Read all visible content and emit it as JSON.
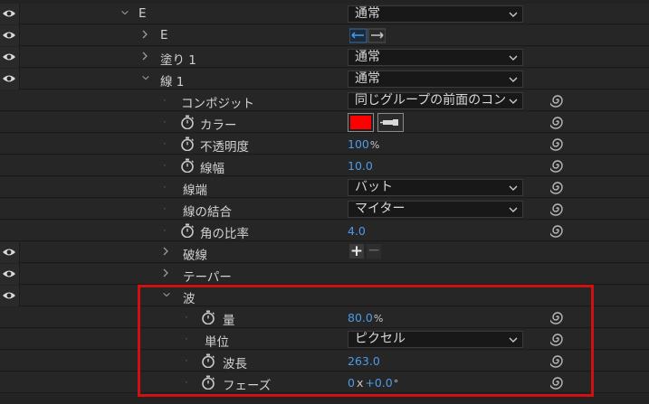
{
  "rows": [
    {
      "label": "E",
      "dropdown": "通常"
    },
    {
      "label": "E"
    },
    {
      "label": "塗り 1",
      "dropdown": "通常"
    },
    {
      "label": "線 1",
      "dropdown": "通常"
    },
    {
      "label": "コンポジット",
      "dropdown": "同じグループの前面のコン"
    },
    {
      "label": "カラー",
      "color": "#ff0000"
    },
    {
      "label": "不透明度",
      "value": "100",
      "unit": "%"
    },
    {
      "label": "線幅",
      "value": "10.0"
    },
    {
      "label": "線端",
      "dropdown": "バット"
    },
    {
      "label": "線の結合",
      "dropdown": "マイター"
    },
    {
      "label": "角の比率",
      "value": "4.0"
    },
    {
      "label": "破線",
      "plus": "+",
      "minus": "−"
    },
    {
      "label": "テーパー"
    },
    {
      "label": "波"
    },
    {
      "label": "量",
      "value": "80.0",
      "unit": "%"
    },
    {
      "label": "単位",
      "dropdown": "ピクセル"
    },
    {
      "label": "波長",
      "value": "263.0"
    },
    {
      "label": "フェーズ",
      "value": "0",
      "value2": "+0.0",
      "mult": "x",
      "deg": "°"
    }
  ],
  "colors": {
    "accent_value": "#4c9be8",
    "highlight_border": "#d11111",
    "swatch": "#ff0000"
  },
  "icons": [
    "eye-icon",
    "chevron-icon",
    "stopwatch-icon",
    "expression-spiral-icon",
    "dropdown-arrow-icon",
    "eyedropper-icon",
    "blend-mode-icon"
  ]
}
